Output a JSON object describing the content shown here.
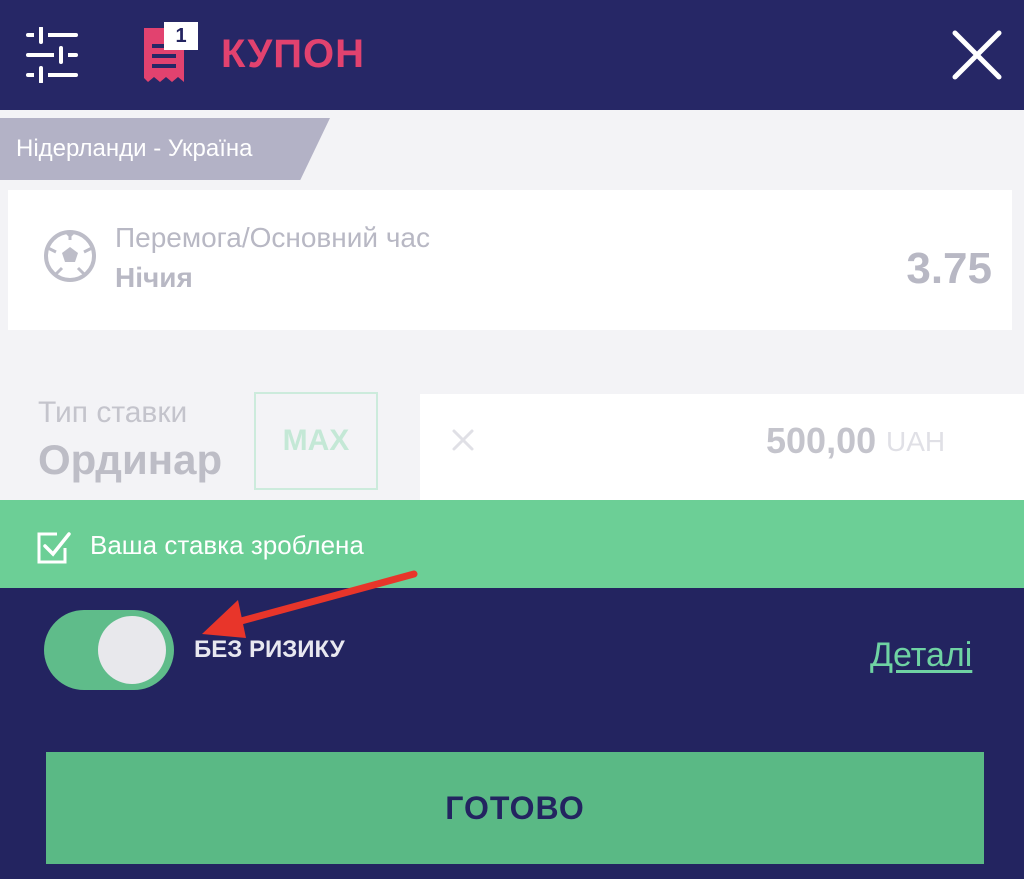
{
  "header": {
    "title": "КУПОН",
    "coupon_count": "1",
    "accent_color": "#e2426f",
    "icons": [
      "filter-icon",
      "coupon-icon",
      "close-icon"
    ]
  },
  "bet": {
    "match": "Нідерланди - Україна",
    "market": "Перемога/Основний час",
    "selection": "Нічия",
    "odds": "3.75",
    "sport_icon": "football-icon"
  },
  "stake": {
    "type_label": "Тип ставки",
    "type_value": "Ординар",
    "max_label": "MAX",
    "amount": "500,00",
    "currency": "UAH"
  },
  "status": {
    "message": "Ваша ставка зроблена",
    "color": "#6ccf96"
  },
  "no_risk": {
    "label": "БЕЗ РИЗИКУ",
    "enabled": true,
    "details_label": "Деталі"
  },
  "actions": {
    "done_label": "ГОТОВО"
  }
}
